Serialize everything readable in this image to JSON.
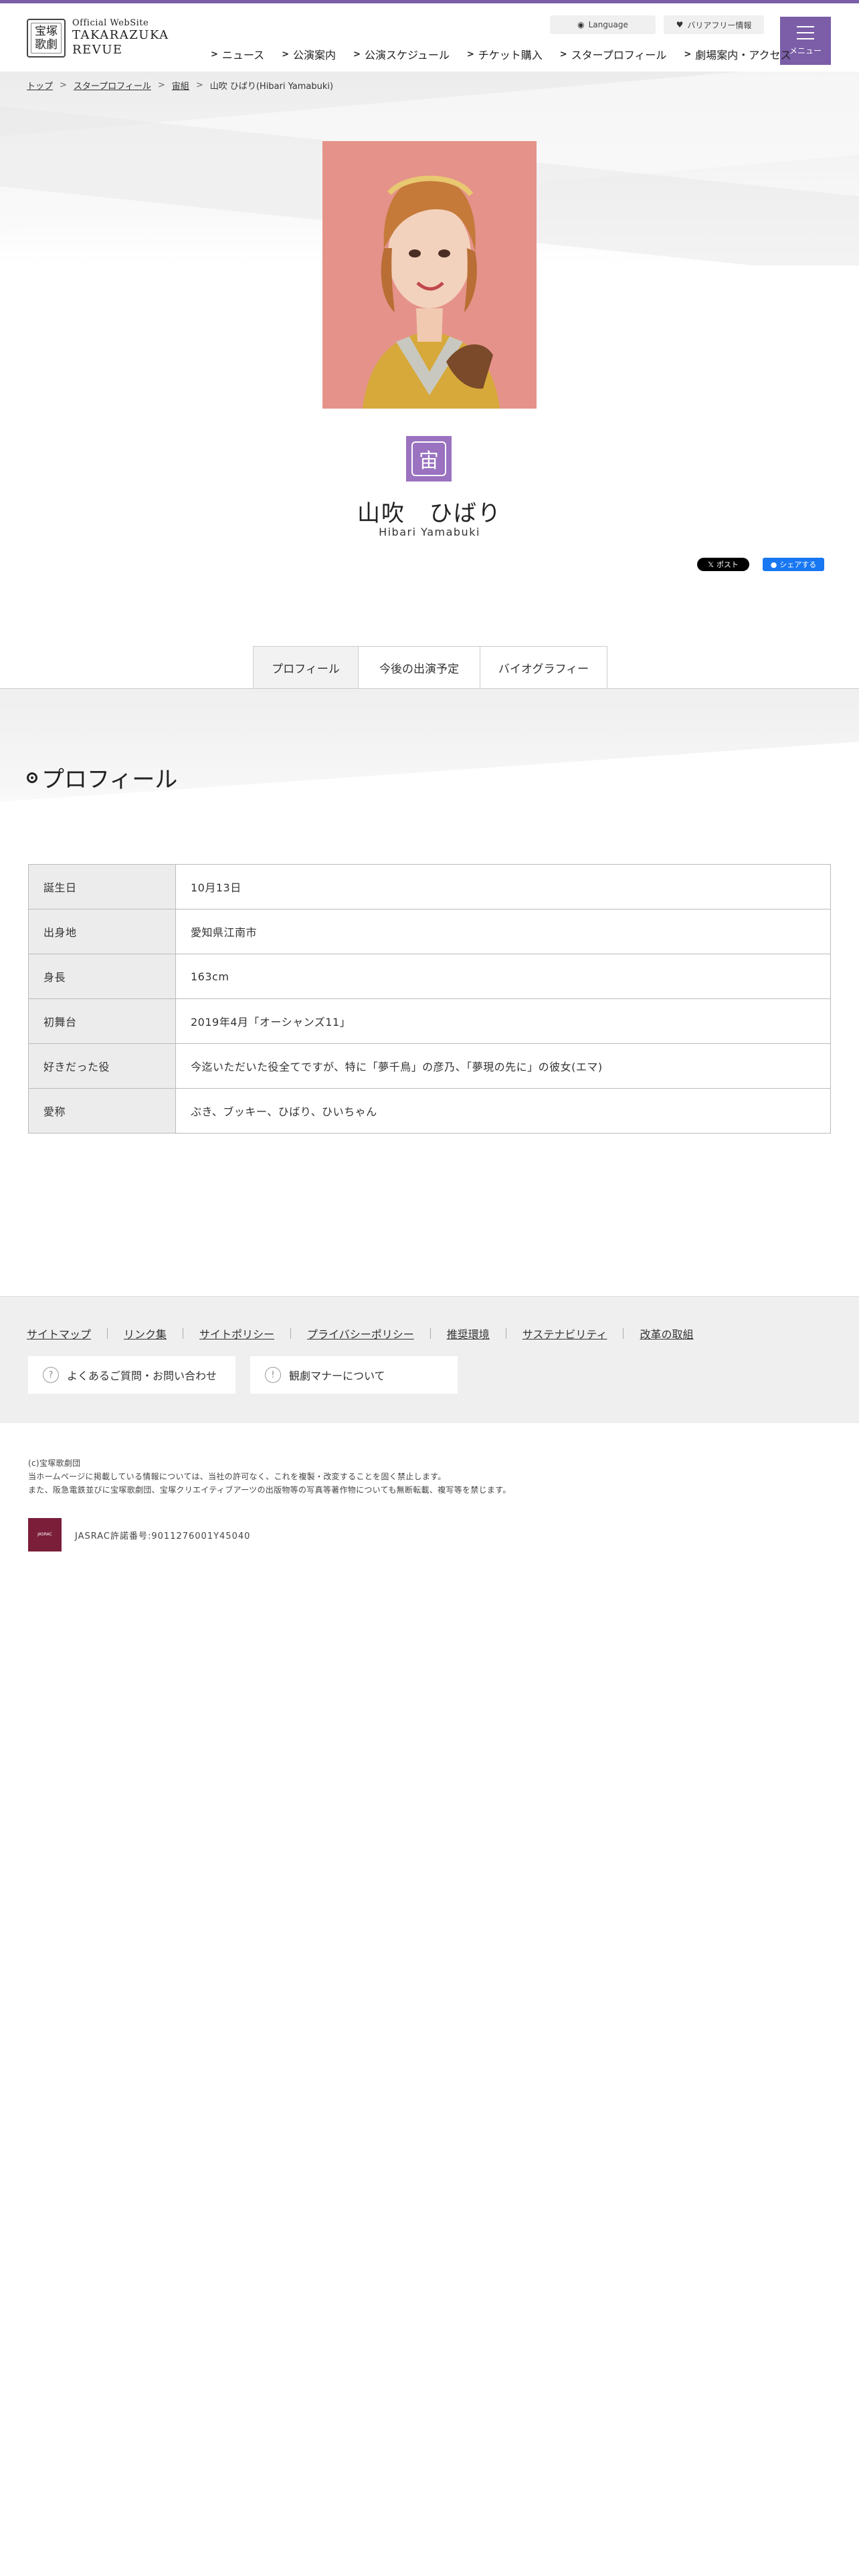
{
  "header": {
    "logo_mark_line1": "宝塚",
    "logo_mark_line2": "歌劇",
    "logo_official": "Official WebSite",
    "logo_name_line1": "TAKARAZUKA",
    "logo_name_line2": "REVUE",
    "language_label": "Language",
    "barrier_free_label": "バリアフリー情報",
    "menu_label": "メニュー",
    "nav": [
      {
        "label": "ニュース"
      },
      {
        "label": "公演案内"
      },
      {
        "label": "公演スケジュール"
      },
      {
        "label": "チケット購入"
      },
      {
        "label": "スタープロフィール"
      },
      {
        "label": "劇場案内・アクセス"
      }
    ]
  },
  "breadcrumb": {
    "items": [
      "トップ",
      "スタープロフィール",
      "宙組"
    ],
    "current": "山吹 ひばり(Hibari Yamabuki)"
  },
  "star": {
    "troupe_glyph": "宙",
    "name_ja": "山吹　ひばり",
    "name_en": "Hibari Yamabuki"
  },
  "share": {
    "x_label": "ポスト",
    "fb_label": "シェアする"
  },
  "tabs": [
    {
      "label": "プロフィール",
      "active": true
    },
    {
      "label": "今後の出演予定",
      "active": false
    },
    {
      "label": "バイオグラフィー",
      "active": false
    }
  ],
  "profile": {
    "section_title": "プロフィール",
    "rows": [
      {
        "key": "誕生日",
        "value": "10月13日"
      },
      {
        "key": "出身地",
        "value": "愛知県江南市"
      },
      {
        "key": "身長",
        "value": "163cm"
      },
      {
        "key": "初舞台",
        "value": "2019年4月「オーシャンズ11」"
      },
      {
        "key": "好きだった役",
        "value": "今迄いただいた役全てですが、特に「夢千鳥」の彦乃、「夢現の先に」の彼女(エマ)"
      },
      {
        "key": "愛称",
        "value": "ぶき、ブッキー、ひばり、ひいちゃん"
      }
    ]
  },
  "footer": {
    "links": [
      "サイトマップ",
      "リンク集",
      "サイトポリシー",
      "プライバシーポリシー",
      "推奨環境",
      "サステナビリティ",
      "改革の取組"
    ],
    "faq_label": "よくあるご質問・お問い合わせ",
    "manner_label": "観劇マナーについて",
    "copy_line1": "(c)宝塚歌劇団",
    "copy_line2": "当ホームページに掲載している情報については、当社の許可なく、これを複製・改変することを固く禁止します。",
    "copy_line3": "また、阪急電鉄並びに宝塚歌劇団、宝塚クリエイティブアーツの出版物等の写真等著作物についても無断転載、複写等を禁じます。",
    "jasrac_logo_text": "JASRAC",
    "jasrac_text": "JASRAC許諾番号:9011276001Y45040"
  },
  "colors": {
    "accent_purple": "#7b5ea7",
    "troupe_badge": "#9a72c0",
    "fb_blue": "#1877f2"
  }
}
